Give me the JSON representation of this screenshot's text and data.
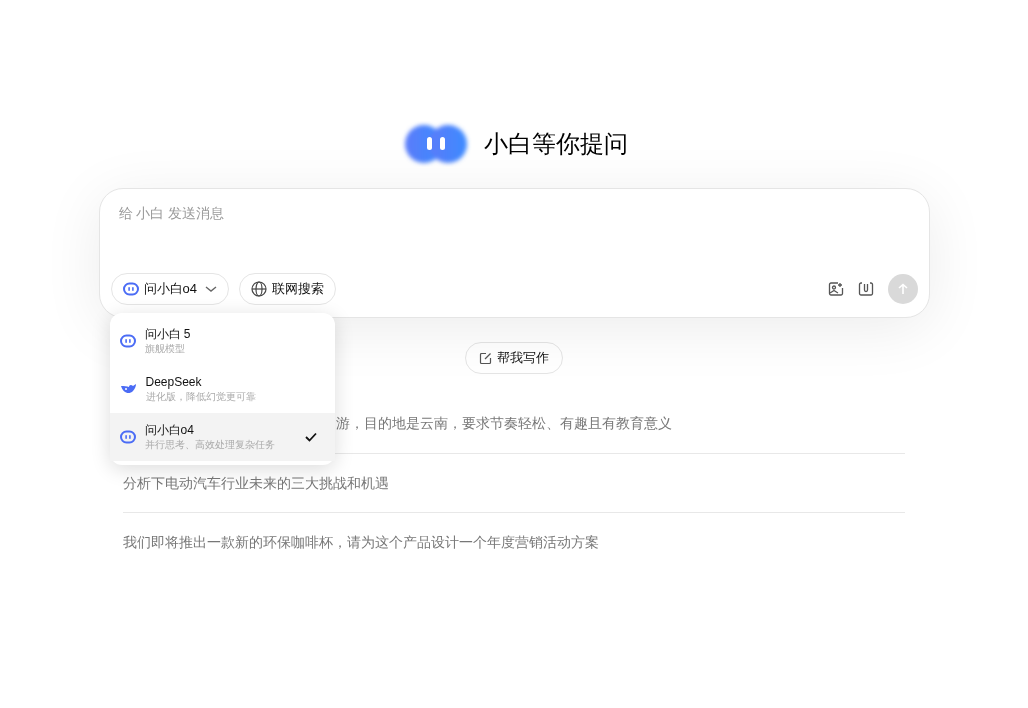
{
  "heading": "小白等你提问",
  "composer": {
    "placeholder": "给 小白 发送消息",
    "model_button": "问小白o4",
    "search_button": "联网搜索"
  },
  "model_menu": {
    "open": true,
    "items": [
      {
        "kind": "robot",
        "title": "问小白 5",
        "subtitle": "旗舰模型",
        "selected": false
      },
      {
        "kind": "whale",
        "title": "DeepSeek",
        "subtitle": "进化版，降低幻觉更可靠",
        "selected": false
      },
      {
        "kind": "robot",
        "title": "问小白o4",
        "subtitle": "并行思考、高效处理复杂任务",
        "selected": true
      }
    ]
  },
  "write_button": "帮我写作",
  "suggestions": [
    {
      "text": "游，目的地是云南，要求节奏轻松、有趣且有教育意义",
      "kind": "clipped"
    },
    {
      "text": "分析下电动汽车行业未来的三大挑战和机遇",
      "kind": "full"
    },
    {
      "text": "我们即将推出一款新的环保咖啡杯，请为这个产品设计一个年度营销活动方案",
      "kind": "full"
    }
  ]
}
